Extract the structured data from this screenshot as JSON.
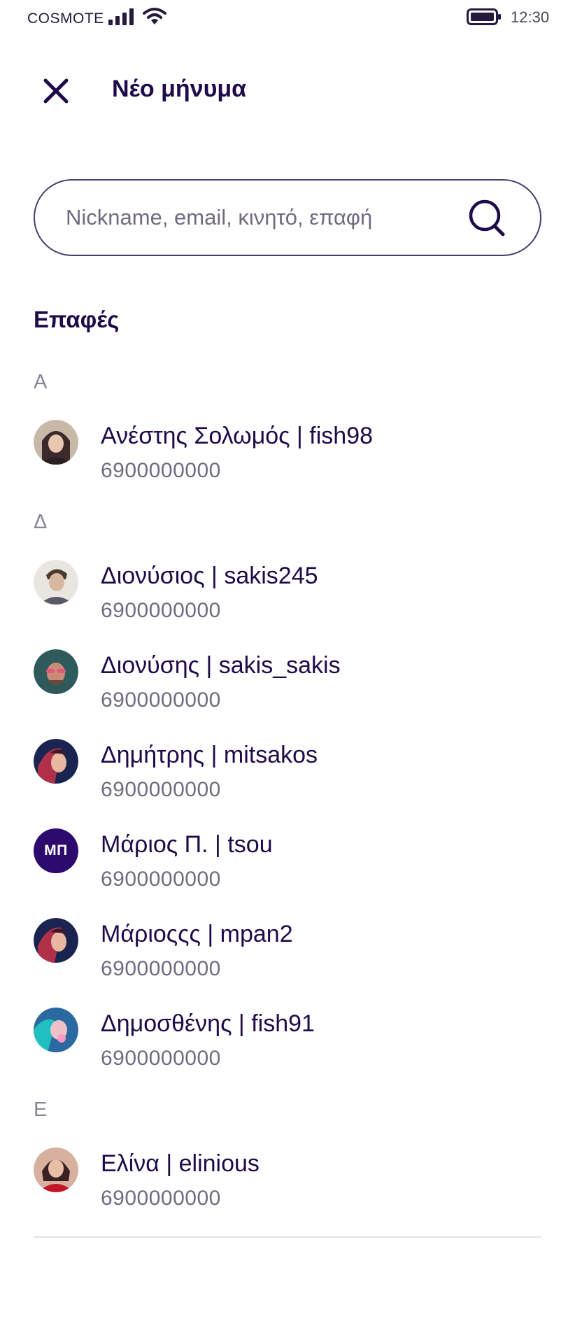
{
  "status_bar": {
    "carrier": "COSMOTE",
    "time": "12:30",
    "icons": [
      "signal-icon",
      "wifi-icon",
      "battery-icon"
    ]
  },
  "header": {
    "title": "Νέο μήνυμα",
    "close_icon": "close-icon"
  },
  "search": {
    "placeholder": "Nickname, email, κινητό, επαφή",
    "value": "",
    "icon": "search-icon"
  },
  "contacts_section": {
    "title": "Επαφές",
    "letters": [
      "Α",
      "Δ",
      "Ε"
    ],
    "items": [
      {
        "name": "Ανέστης Σολωμός | fish98",
        "phone": "6900000000",
        "avatar": "photo",
        "avatar_colors": [
          "#c7b8a8",
          "#3b2a2a",
          "#e8c8b0"
        ]
      },
      {
        "name": "Διονύσιος | sakis245",
        "phone": "6900000000",
        "avatar": "photo",
        "avatar_colors": [
          "#e9e6e2",
          "#4a3a30",
          "#d8b8a0"
        ]
      },
      {
        "name": "Διονύσης | sakis_sakis",
        "phone": "6900000000",
        "avatar": "photo",
        "avatar_colors": [
          "#2f5a5c",
          "#c98a78",
          "#e05a78"
        ]
      },
      {
        "name": "Δημήτρης | mitsakos",
        "phone": "6900000000",
        "avatar": "photo",
        "avatar_colors": [
          "#1a2450",
          "#b0304a",
          "#e8b8a0"
        ]
      },
      {
        "name": "Μάριος Π. | tsou",
        "phone": "6900000000",
        "avatar": "initials",
        "initials": "ΜΠ"
      },
      {
        "name": "Μάριοςςς | mpan2",
        "phone": "6900000000",
        "avatar": "photo",
        "avatar_colors": [
          "#1a2450",
          "#b0304a",
          "#e8b8a0"
        ]
      },
      {
        "name": "Δημοσθένης | fish91",
        "phone": "6900000000",
        "avatar": "photo",
        "avatar_colors": [
          "#2a6aa0",
          "#20c0c0",
          "#f0c0c8"
        ]
      },
      {
        "name": "Ελίνα | elinious",
        "phone": "6900000000",
        "avatar": "photo",
        "avatar_colors": [
          "#d8b0a0",
          "#c01828",
          "#3a2020"
        ]
      }
    ]
  },
  "colors": {
    "primary": "#1f0a4a",
    "secondary_text": "#726a80",
    "letter_text": "#8a8496",
    "initials_bg": "#2d0a6e",
    "border": "#4a3d6e"
  }
}
